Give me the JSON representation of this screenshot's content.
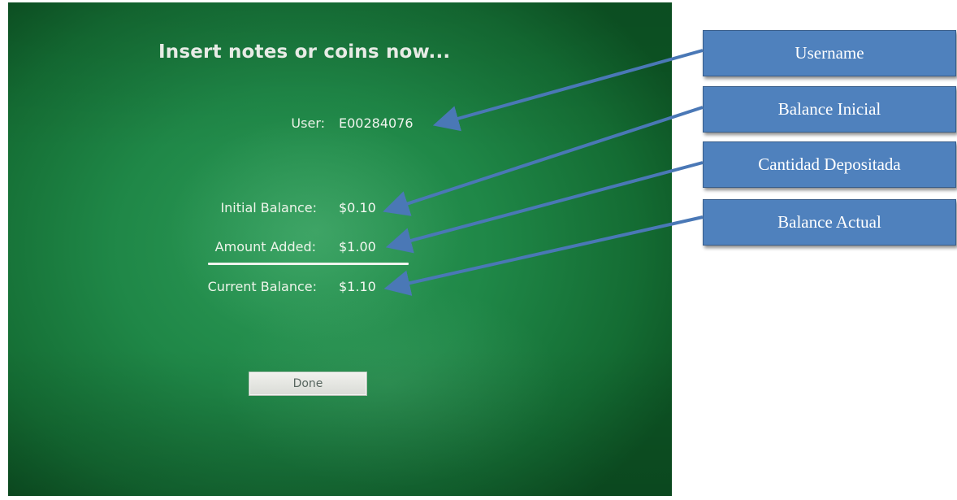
{
  "screen": {
    "heading": "Insert notes or coins now...",
    "user_label": "User:",
    "user_value": "E00284076",
    "initial_balance_label": "Initial Balance:",
    "initial_balance_value": "$0.10",
    "amount_added_label": "Amount Added:",
    "amount_added_value": "$1.00",
    "current_balance_label": "Current Balance:",
    "current_balance_value": "$1.10",
    "done_label": "Done"
  },
  "annotations": [
    {
      "label": "Username"
    },
    {
      "label": "Balance Inicial"
    },
    {
      "label": "Cantidad Depositada"
    },
    {
      "label": "Balance Actual"
    }
  ],
  "colors": {
    "screen_green": "#1f8747",
    "callout_blue": "#4f81bd",
    "arrow_blue": "#4a78b6"
  }
}
